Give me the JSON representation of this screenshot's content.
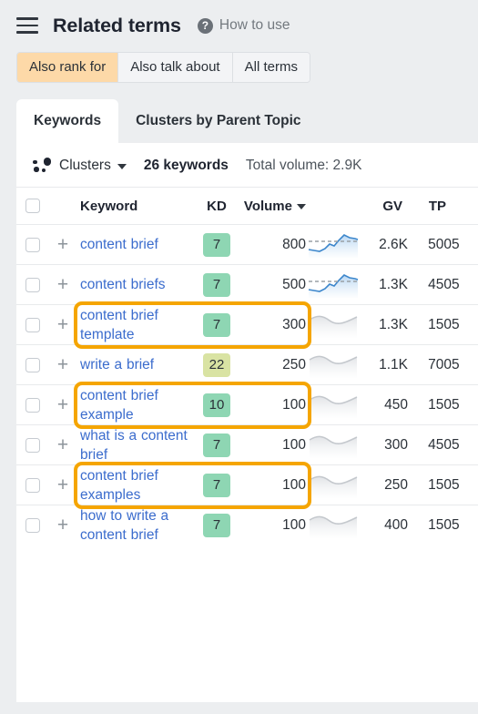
{
  "header": {
    "menu_icon": "hamburger-icon",
    "title": "Related terms",
    "help_icon_glyph": "?",
    "help_label": "How to use"
  },
  "segmented_control": {
    "options": [
      {
        "label": "Also rank for",
        "active": true
      },
      {
        "label": "Also talk about",
        "active": false
      },
      {
        "label": "All terms",
        "active": false
      }
    ]
  },
  "tabs": [
    {
      "label": "Keywords",
      "active": true
    },
    {
      "label": "Clusters by Parent Topic",
      "active": false
    }
  ],
  "toolbar": {
    "clusters_icon": "clusters-dots-icon",
    "clusters_label": "Clusters",
    "keyword_count": "26 keywords",
    "total_volume": "Total volume: 2.9K"
  },
  "table": {
    "columns": [
      {
        "key": "checkbox",
        "label": ""
      },
      {
        "key": "add",
        "label": ""
      },
      {
        "key": "keyword",
        "label": "Keyword"
      },
      {
        "key": "kd",
        "label": "KD"
      },
      {
        "key": "volume",
        "label": "Volume",
        "sorted": true,
        "sort_dir": "desc"
      },
      {
        "key": "trend",
        "label": ""
      },
      {
        "key": "gv",
        "label": "GV"
      },
      {
        "key": "tp",
        "label": "TP"
      },
      {
        "key": "cut",
        "label": ""
      }
    ],
    "rows": [
      {
        "keyword": "content brief",
        "kd": "7",
        "kd_color": "#8ed6b3",
        "volume": "800",
        "trend": "blue-rising",
        "gv": "2.6K",
        "tp": "500",
        "cut": "5",
        "highlighted": false
      },
      {
        "keyword": "content briefs",
        "kd": "7",
        "kd_color": "#8ed6b3",
        "volume": "500",
        "trend": "blue-rising",
        "gv": "1.3K",
        "tp": "450",
        "cut": "5",
        "highlighted": false
      },
      {
        "keyword": "content brief template",
        "kd": "7",
        "kd_color": "#8ed6b3",
        "volume": "300",
        "trend": "gray-flat",
        "gv": "1.3K",
        "tp": "150",
        "cut": "5",
        "highlighted": true
      },
      {
        "keyword": "write a brief",
        "kd": "22",
        "kd_color": "#d9e3a3",
        "volume": "250",
        "trend": "gray-flat",
        "gv": "1.1K",
        "tp": "700",
        "cut": "5",
        "highlighted": false
      },
      {
        "keyword": "content brief example",
        "kd": "10",
        "kd_color": "#8ed6b3",
        "volume": "100",
        "trend": "gray-flat",
        "gv": "450",
        "tp": "150",
        "cut": "5",
        "highlighted": true
      },
      {
        "keyword": "what is a content brief",
        "kd": "7",
        "kd_color": "#8ed6b3",
        "volume": "100",
        "trend": "gray-flat",
        "gv": "300",
        "tp": "450",
        "cut": "5",
        "highlighted": false
      },
      {
        "keyword": "content brief examples",
        "kd": "7",
        "kd_color": "#8ed6b3",
        "volume": "100",
        "trend": "gray-flat",
        "gv": "250",
        "tp": "150",
        "cut": "5",
        "highlighted": true
      },
      {
        "keyword": "how to write a content brief",
        "kd": "7",
        "kd_color": "#8ed6b3",
        "volume": "100",
        "trend": "gray-flat",
        "gv": "400",
        "tp": "150",
        "cut": "5",
        "highlighted": false
      }
    ]
  },
  "colors": {
    "page_background": "#eceef0",
    "panel_background": "#ffffff",
    "accent_active_segment": "#fdd9a8",
    "link": "#3b6ccd",
    "highlight_border": "#f5a500",
    "kd_low": "#8ed6b3",
    "kd_mid": "#d9e3a3",
    "trend_blue": "#4a90d9",
    "trend_gray": "#c9ccd0"
  }
}
